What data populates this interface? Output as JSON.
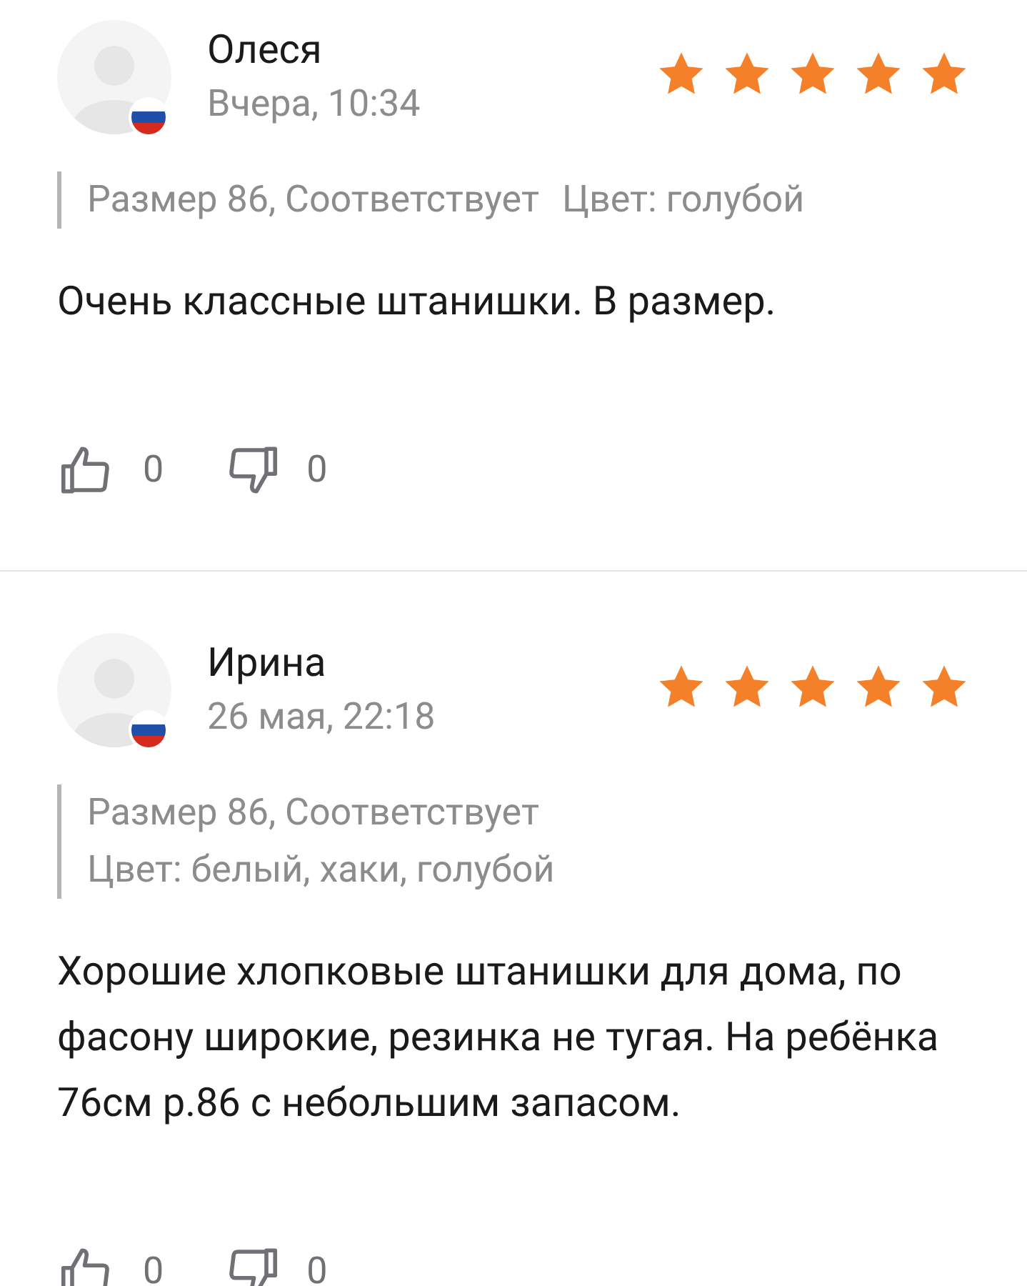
{
  "reviews": [
    {
      "author": "Олеся",
      "date": "Вчера, 10:34",
      "stars": 5,
      "attributes": [
        "Размер 86, Соответствует",
        "Цвет: голубой"
      ],
      "text": "Очень классные штанишки. В размер.",
      "likes": "0",
      "dislikes": "0"
    },
    {
      "author": "Ирина",
      "date": "26 мая, 22:18",
      "stars": 5,
      "attributes": [
        "Размер 86, Соответствует",
        "Цвет: белый, хаки, голубой"
      ],
      "text": "Хорошие хлопковые штанишки для дома, по фасону широкие, резинка не тугая. На ребёнка 76см р.86 с небольшим запасом.",
      "likes": "0",
      "dislikes": "0"
    }
  ]
}
